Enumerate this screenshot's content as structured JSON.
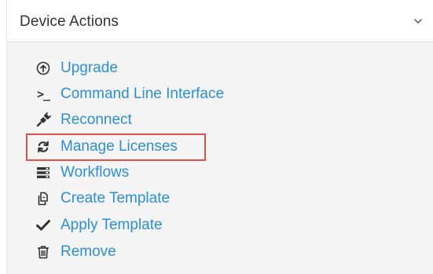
{
  "panel": {
    "title": "Device Actions"
  },
  "actions": [
    {
      "label": "Upgrade",
      "icon": "upgrade-circle-icon"
    },
    {
      "label": "Command Line Interface",
      "icon": "terminal-prompt-icon",
      "glyph": ">_"
    },
    {
      "label": "Reconnect",
      "icon": "plug-icon"
    },
    {
      "label": "Manage Licenses",
      "icon": "refresh-icon",
      "highlighted": true
    },
    {
      "label": "Workflows",
      "icon": "list-icon"
    },
    {
      "label": "Create Template",
      "icon": "copy-icon"
    },
    {
      "label": "Apply Template",
      "icon": "checkmark-icon"
    },
    {
      "label": "Remove",
      "icon": "trash-icon"
    }
  ],
  "colors": {
    "link": "#2b8fd8",
    "highlight_border": "#e0524d",
    "panel_bg": "#f5f5f5",
    "icon": "#333333"
  }
}
